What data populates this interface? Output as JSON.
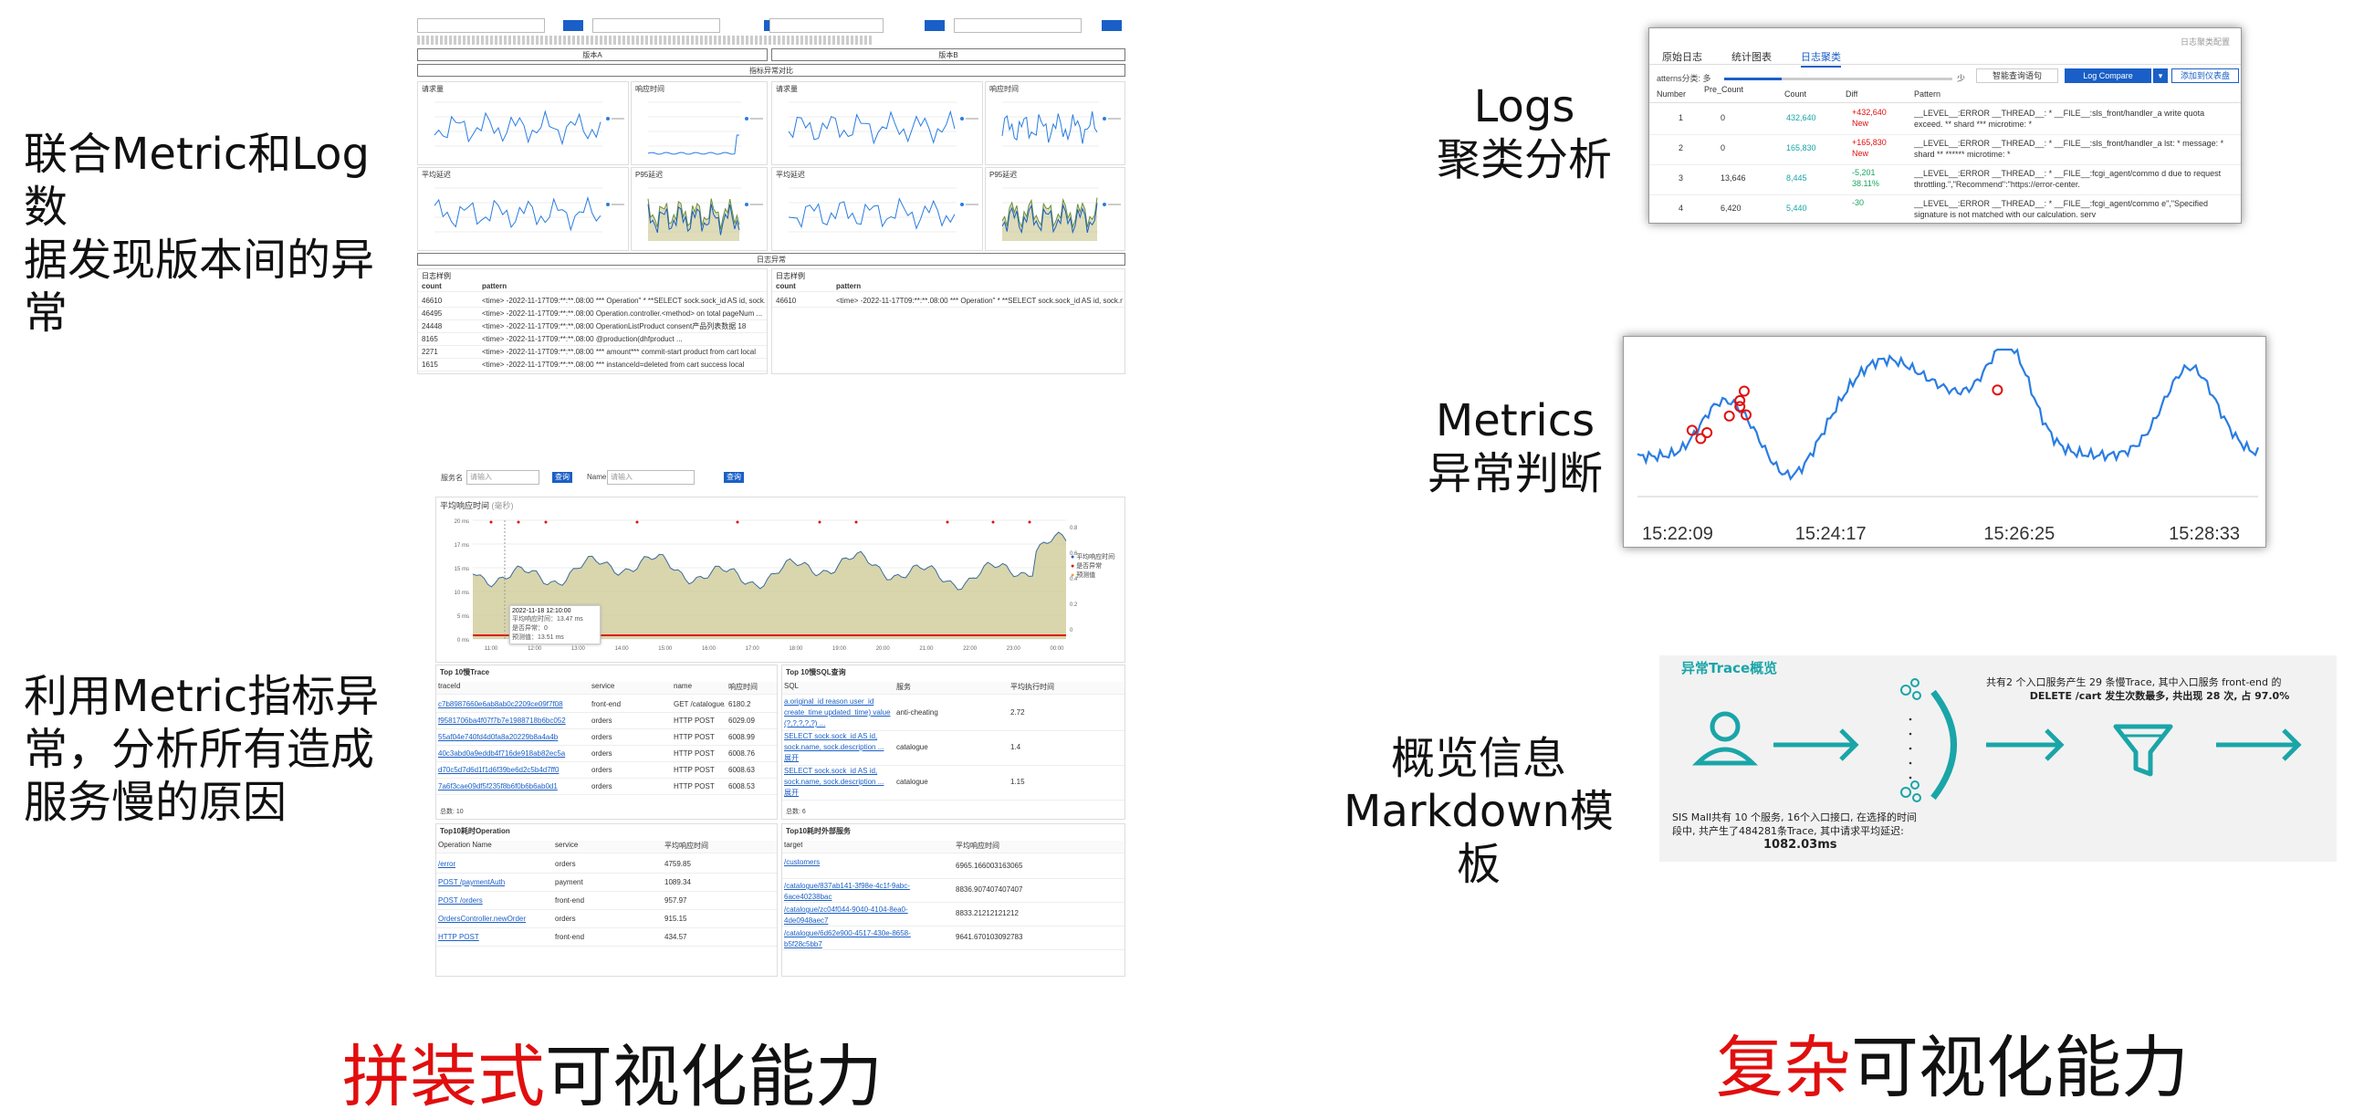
{
  "left_captions": {
    "top": [
      "联合Metric和Log数",
      "据发现版本间的异",
      "常"
    ],
    "bottom": [
      "利用Metric指标异",
      "常，分析所有造成",
      "服务慢的原因"
    ]
  },
  "right_captions": {
    "logs": [
      "Logs",
      "聚类分析"
    ],
    "metrics": [
      "Metrics",
      "异常判断"
    ],
    "overview": [
      "概览信息",
      "Markdown模板"
    ]
  },
  "footer": {
    "left": {
      "highlight": "拼装式",
      "rest": "可视化能力"
    },
    "right": {
      "highlight": "复杂",
      "rest": "可视化能力"
    }
  },
  "colors": {
    "accent_red": "#e10e0e",
    "brand_blue": "#1a5fc7",
    "teal": "#1aa5a8"
  },
  "dash1": {
    "version_a": "版本A",
    "version_b": "版本B",
    "compare_title": "指标异常对比",
    "log_title": "日志异常",
    "panel_titles": [
      "请求量",
      "响应时间",
      "请求量",
      "响应时间",
      "平均延迟",
      "P95延迟",
      "平均延迟",
      "P95延迟"
    ],
    "log_headers": [
      "count",
      "pattern"
    ],
    "log_rows": [
      {
        "count": "46610",
        "pattern": "<time> -2022-11-17T09:**:**.08:00 *** Operation\" * **SELECT sock.sock_id AS id, sock.name..."
      },
      {
        "count": "46495",
        "pattern": "<time> -2022-11-17T09:**:**.08:00 Operation.controller.<method> on total pageNum ..."
      },
      {
        "count": "24448",
        "pattern": "<time> -2022-11-17T09:**:**.08:00 OperationListProduct consent产品列表数据 18"
      },
      {
        "count": "8165",
        "pattern": "<time> -2022-11-17T09:**:**.08:00 @production(dhfproduct ..."
      },
      {
        "count": "2271",
        "pattern": "<time> -2022-11-17T09:**:**.08:00 *** amount*** commit-start product from cart local"
      },
      {
        "count": "1615",
        "pattern": "<time> -2022-11-17T09:**:**.08:00 *** instanceId=deleted from cart success local"
      }
    ],
    "log_rows_b": [
      {
        "count": "46610",
        "pattern": "<time> -2022-11-17T09:**:**.08:00 *** Operation\" * **SELECT sock.sock_id AS id, sock.name..."
      }
    ]
  },
  "dash2": {
    "service_label": "服务名",
    "service_placeholder": "请输入",
    "name_label": "Name",
    "name_placeholder": "请输入",
    "query": "查询",
    "chart_title": "平均响应时间",
    "chart_unit": "(毫秒)",
    "legend": [
      "平均响应时间",
      "是否异常",
      "预测值"
    ],
    "tooltip": [
      "2022-11-18 12:10:00",
      "平均响应时间：13.47 ms",
      "是否异常：0",
      "预测值：13.51 ms"
    ],
    "y_ticks": [
      "20 ms",
      "17 ms",
      "15 ms",
      "10 ms",
      "5 ms",
      "0 ms"
    ],
    "y2_ticks": [
      "0.8",
      "0.6",
      "0.4",
      "0.2",
      "0"
    ],
    "x_ticks": [
      "11:00",
      "12:00",
      "13:00",
      "14:00",
      "15:00",
      "16:00",
      "17:00",
      "18:00",
      "19:00",
      "20:00",
      "21:00",
      "22:00",
      "23:00",
      "00:00"
    ],
    "trace_title": "Top 10慢Trace",
    "trace_headers": [
      "traceId",
      "service",
      "name",
      "响应时间"
    ],
    "trace_rows": [
      {
        "id": "c7b8987660e6ab8ab0c2209ce09f7f08",
        "svc": "front-end",
        "name": "GET /catalogue/",
        "t": "6180.2"
      },
      {
        "id": "f9581706ba4f07f7b7e1988718b6bc052",
        "svc": "orders",
        "name": "HTTP POST",
        "t": "6029.09"
      },
      {
        "id": "55af04e740fd4d0fa8a20229b8a4a4b",
        "svc": "orders",
        "name": "HTTP POST",
        "t": "6008.99"
      },
      {
        "id": "40c3abd0a9eddb4f716de918ab82ec5a",
        "svc": "orders",
        "name": "HTTP POST",
        "t": "6008.76"
      },
      {
        "id": "d70c5d7d6d1f1d6f39be6d2c5b4d7ff0",
        "svc": "orders",
        "name": "HTTP POST",
        "t": "6008.63"
      },
      {
        "id": "7a6f3cae09df5f235f8b6f0b6b6ab0d1",
        "svc": "orders",
        "name": "HTTP POST",
        "t": "6008.53"
      }
    ],
    "trace_total": "总数: 10",
    "sql_title": "Top 10慢SQL查询",
    "sql_headers": [
      "SQL",
      "服务",
      "平均执行时间"
    ],
    "sql_rows": [
      {
        "sql": "a.original_id reason user_id create_time updated_time) value (?,?,?,?,?) ...",
        "svc": "anti-cheating",
        "t": "2.72"
      },
      {
        "sql": "SELECT sock.sock_id AS id, sock.name, sock.description ... 展开",
        "svc": "catalogue",
        "t": "1.4"
      },
      {
        "sql": "SELECT sock.sock_id AS id, sock.name, sock.description ... 展开",
        "svc": "catalogue",
        "t": "1.15"
      }
    ],
    "sql_total": "总数: 6",
    "op_title": "Top10耗时Operation",
    "op_headers": [
      "Operation Name",
      "service",
      "平均响应时间"
    ],
    "op_rows": [
      {
        "n": "/error",
        "s": "orders",
        "t": "4759.85"
      },
      {
        "n": "POST /paymentAuth",
        "s": "payment",
        "t": "1089.34"
      },
      {
        "n": "POST /orders",
        "s": "front-end",
        "t": "957.97"
      },
      {
        "n": "OrdersController.newOrder",
        "s": "orders",
        "t": "915.15"
      },
      {
        "n": "HTTP POST",
        "s": "front-end",
        "t": "434.57"
      }
    ],
    "ext_title": "Top10耗时外部服务",
    "ext_headers": [
      "target",
      "平均响应时间"
    ],
    "ext_rows": [
      {
        "n": "/customers",
        "t": "6965.166003163065"
      },
      {
        "n": "/catalogue/837ab141-3f98e-4c1f-9abc-6ace40238bac",
        "t": "8836.907407407407"
      },
      {
        "n": "/catalogue/zc04f044-9040-4104-8ea0-4de0948aec7",
        "t": "8833.21212121212"
      },
      {
        "n": "/catalogue/6d62e900-4517-430e-8658-b5f28c5bb7",
        "t": "9641.670103092783"
      }
    ]
  },
  "logs_panel": {
    "tabs": [
      "原始日志",
      "统计图表",
      "日志聚类"
    ],
    "top_right": "日志聚类配置",
    "slider_label": "atterns分类: 多",
    "slider_right": "少",
    "reorder": "智能查询语句",
    "compare": "Log Compare",
    "add": "添加到仪表盘",
    "headers": [
      "Number",
      "Pre_Count",
      "Count",
      "Diff",
      "Pattern"
    ],
    "rows": [
      {
        "n": "1",
        "pre": "0",
        "cnt": "432,640",
        "diff": "+432,640",
        "sub": "New",
        "pat": "__LEVEL__:ERROR __THREAD__: * __FILE__:sls_front/handler_a write quota exceed. ** shard *** microtime: *"
      },
      {
        "n": "2",
        "pre": "0",
        "cnt": "165,830",
        "diff": "+165,830",
        "sub": "New",
        "pat": "__LEVEL__:ERROR __THREAD__: * __FILE__:sls_front/handler_a lst: * message: * shard ** ****** microtime: *"
      },
      {
        "n": "3",
        "pre": "13,646",
        "cnt": "8,445",
        "diff": "-5,201",
        "sub": "38.11%",
        "pat": "__LEVEL__:ERROR __THREAD__: * __FILE__:fcgi_agent/commo d due to request throttling.\",\"Recommend\":\"https://error-center."
      },
      {
        "n": "4",
        "pre": "6,420",
        "cnt": "5,440",
        "diff": "-30",
        "sub": "",
        "pat": "__LEVEL__:ERROR __THREAD__: * __FILE__:fcgi_agent/commo e\",\"Specified signature is not matched with our calculation. serv"
      }
    ]
  },
  "metrics_panel": {
    "x_ticks": [
      "15:22:09",
      "15:24:17",
      "15:26:25",
      "15:28:33"
    ]
  },
  "overview_panel": {
    "title": "异常Trace概览",
    "right_text_1": "共有2 个入口服务产生 29 条慢Trace, 其中入口服务 front-end 的",
    "right_text_2": "DELETE /cart 发生次数最多, 共出现 28 次, 占 97.0%",
    "bottom_text_1": "SIS Mall共有 10 个服务, 16个入口接口, 在选择的时间",
    "bottom_text_2": "段中, 共产生了484281条Trace, 其中请求平均延迟:",
    "bottom_text_3": "1082.03ms"
  }
}
